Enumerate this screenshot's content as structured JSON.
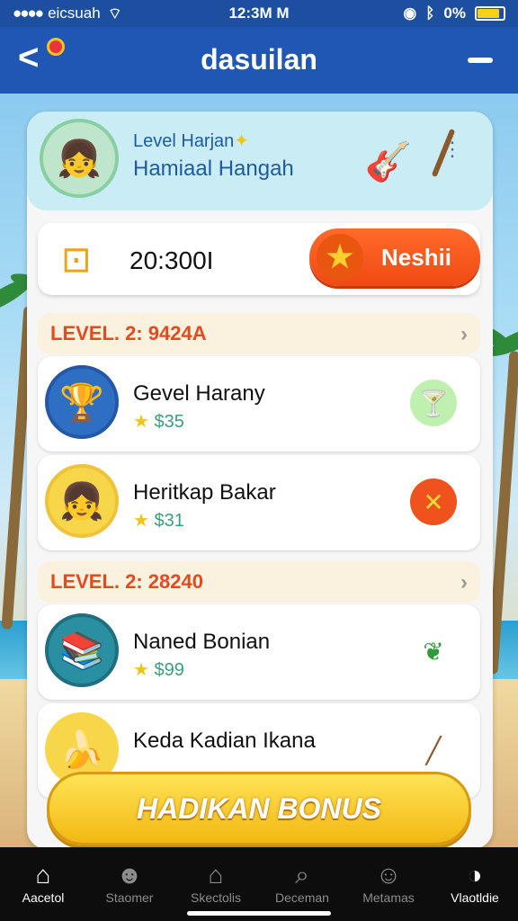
{
  "status_bar": {
    "signal": "●●●●",
    "carrier": "eicsuah",
    "time": "12:3M M",
    "battery_text": "0%"
  },
  "header": {
    "title": "dasuilan",
    "back_icon": "chevron-left-icon",
    "menu_icon": "menu-icon"
  },
  "profile": {
    "level_name": "Level Harjan",
    "player_name": "Hamiaal Hangah"
  },
  "balance": {
    "amount": "20:300I",
    "claim_label": "Neshii"
  },
  "sections": [
    {
      "header": "LEVEL. 2: 9424A",
      "items": [
        {
          "title": "Gevel Harany",
          "price": "$35",
          "action_icon": "cocktail-icon",
          "action_color": "#bff0b0"
        },
        {
          "title": "Heritkap Bakar",
          "price": "$31",
          "action_icon": "close-icon",
          "action_color": "#f0521e"
        }
      ]
    },
    {
      "header": "LEVEL. 2: 28240",
      "items": [
        {
          "title": "Naned Bonian",
          "price": "$99",
          "action_icon": "leaf-icon",
          "action_color": "#ffffff"
        },
        {
          "title": "Keda Kadian Ikana",
          "price": "",
          "action_icon": "flute-icon",
          "action_color": "#ffffff"
        }
      ]
    }
  ],
  "bonus_button": "HADIKAN BONUS",
  "bottom_nav": [
    {
      "label": "Aacetol",
      "icon": "home-icon",
      "active": true
    },
    {
      "label": "Staomer",
      "icon": "user-icon",
      "active": false
    },
    {
      "label": "Skectolis",
      "icon": "house-icon",
      "active": false
    },
    {
      "label": "Deceman",
      "icon": "search-icon",
      "active": false
    },
    {
      "label": "Metamas",
      "icon": "user-group-icon",
      "active": false
    },
    {
      "label": "Vlaotldie",
      "icon": "whistle-icon",
      "active": true
    }
  ],
  "colors": {
    "header_blue": "#2057b4",
    "accent_orange": "#f04a14",
    "bonus_yellow": "#f2b812"
  }
}
